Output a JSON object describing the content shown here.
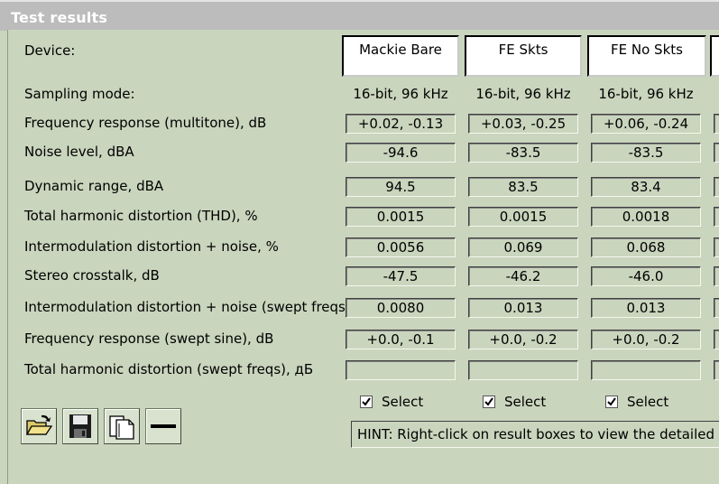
{
  "window": {
    "title": "Test results"
  },
  "rows": {
    "device": "Device:",
    "sampling": "Sampling mode:",
    "freq_multitone": "Frequency response (multitone), dB",
    "noise": "Noise level, dBA",
    "dynamic": "Dynamic range, dBA",
    "thd": "Total harmonic distortion (THD), %",
    "imd": "Intermodulation distortion + noise, %",
    "crosstalk": "Stereo crosstalk, dB",
    "imd_swept": "Intermodulation distortion + noise (swept freqs), %",
    "freq_swept": "Frequency response (swept sine), dB",
    "thd_swept": "Total harmonic distortion (swept freqs), дБ"
  },
  "devices": [
    {
      "name": "Mackie Bare",
      "sampling": "16-bit, 96 kHz",
      "freq_multitone": "+0.02, -0.13",
      "noise": "-94.6",
      "dynamic": "94.5",
      "thd": "0.0015",
      "imd": "0.0056",
      "crosstalk": "-47.5",
      "imd_swept": "0.0080",
      "freq_swept": "+0.0, -0.1",
      "thd_swept": "",
      "select_label": "Select",
      "selected": true
    },
    {
      "name": "FE Skts",
      "sampling": "16-bit, 96 kHz",
      "freq_multitone": "+0.03, -0.25",
      "noise": "-83.5",
      "dynamic": "83.5",
      "thd": "0.0015",
      "imd": "0.069",
      "crosstalk": "-46.2",
      "imd_swept": "0.013",
      "freq_swept": "+0.0, -0.2",
      "thd_swept": "",
      "select_label": "Select",
      "selected": true
    },
    {
      "name": "FE No Skts",
      "sampling": "16-bit, 96 kHz",
      "freq_multitone": "+0.06, -0.24",
      "noise": "-83.5",
      "dynamic": "83.4",
      "thd": "0.0018",
      "imd": "0.068",
      "crosstalk": "-46.0",
      "imd_swept": "0.013",
      "freq_swept": "+0.0, -0.2",
      "thd_swept": "",
      "select_label": "Select",
      "selected": true
    }
  ],
  "toolbar": {
    "icons": [
      "open-folder-icon",
      "save-disk-icon",
      "copy-pages-icon",
      "minus-icon"
    ]
  },
  "hint": "HINT: Right-click on result boxes to view the detailed rep"
}
